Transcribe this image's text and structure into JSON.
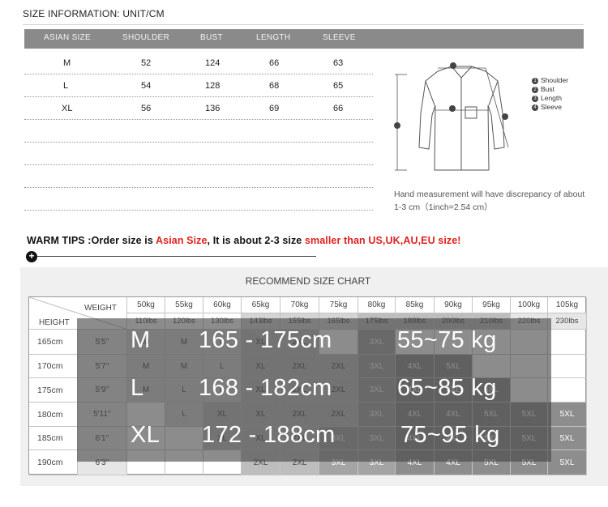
{
  "size_info": {
    "title": "SIZE INFORMATION:  UNIT/CM",
    "headers": [
      "ASIAN SIZE",
      "SHOULDER",
      "BUST",
      "LENGTH",
      "SLEEVE"
    ],
    "rows": [
      [
        "M",
        "52",
        "124",
        "66",
        "63"
      ],
      [
        "L",
        "54",
        "128",
        "68",
        "65"
      ],
      [
        "XL",
        "56",
        "136",
        "69",
        "66"
      ]
    ]
  },
  "legend": [
    {
      "num": "1",
      "label": "Shoulder"
    },
    {
      "num": "2",
      "label": "Bust"
    },
    {
      "num": "3",
      "label": "Length"
    },
    {
      "num": "4",
      "label": "Sleeve"
    }
  ],
  "note": "Hand measurement will have discrepancy of about 1-3 cm（1inch=2.54 cm）",
  "warm_tips": {
    "prefix": "WARM TIPS :Order size is ",
    "asian": "Asian Size",
    "middle": ", It is about 2-3 size ",
    "smaller": "smaller than US,UK,AU,EU size!",
    "plus": "+"
  },
  "chart": {
    "title": "RECOMMEND SIZE CHART",
    "weight_label": "WEIGHT",
    "height_label": "HEIGHT",
    "kg": [
      "50kg",
      "55kg",
      "60kg",
      "65kg",
      "70kg",
      "75kg",
      "80kg",
      "85kg",
      "90kg",
      "95kg",
      "100kg",
      "105kg"
    ],
    "lbs": [
      "110lbs",
      "120lbs",
      "130lbs",
      "143lbs",
      "155lbs",
      "165lbs",
      "175lbs",
      "188lbs",
      "200lbs",
      "210lbs",
      "220lbs",
      "230lbs"
    ],
    "rows": [
      {
        "cm": "165cm",
        "ft": "5'5''",
        "cells": [
          "M",
          "M",
          "L",
          "XL",
          "2XL",
          "",
          "3XL",
          "",
          "",
          "",
          "",
          ""
        ]
      },
      {
        "cm": "170cm",
        "ft": "5'7''",
        "cells": [
          "M",
          "M",
          "L",
          "XL",
          "2XL",
          "2XL",
          "3XL",
          "4XL",
          "5XL",
          "",
          "",
          ""
        ]
      },
      {
        "cm": "175cm",
        "ft": "5'9''",
        "cells": [
          "M",
          "L",
          "L",
          "XL",
          "2XL",
          "2XL",
          "3XL",
          "4XL",
          "4XL",
          "5XL",
          "",
          ""
        ]
      },
      {
        "cm": "180cm",
        "ft": "5'11''",
        "cells": [
          "",
          "L",
          "XL",
          "XL",
          "2XL",
          "2XL",
          "3XL",
          "4XL",
          "4XL",
          "5XL",
          "5XL",
          "5XL"
        ]
      },
      {
        "cm": "185cm",
        "ft": "6'1''",
        "cells": [
          "",
          "",
          "XL",
          "XL",
          "2XL",
          "3XL",
          "3XL",
          "4XL",
          "4XL",
          "5XL",
          "5XL",
          "5XL"
        ]
      },
      {
        "cm": "190cm",
        "ft": "6'3''",
        "cells": [
          "",
          "",
          "",
          "2XL",
          "2XL",
          "3XL",
          "3XL",
          "4XL",
          "4XL",
          "5XL",
          "5XL",
          "5XL"
        ]
      }
    ]
  },
  "overlay": [
    {
      "size": "M",
      "height": "165 - 175cm",
      "weight": "55~75 kg"
    },
    {
      "size": "L",
      "height": "168 - 182cm",
      "weight": "65~85 kg"
    },
    {
      "size": "XL",
      "height": "172 - 188cm",
      "weight": "75~95 kg"
    }
  ]
}
